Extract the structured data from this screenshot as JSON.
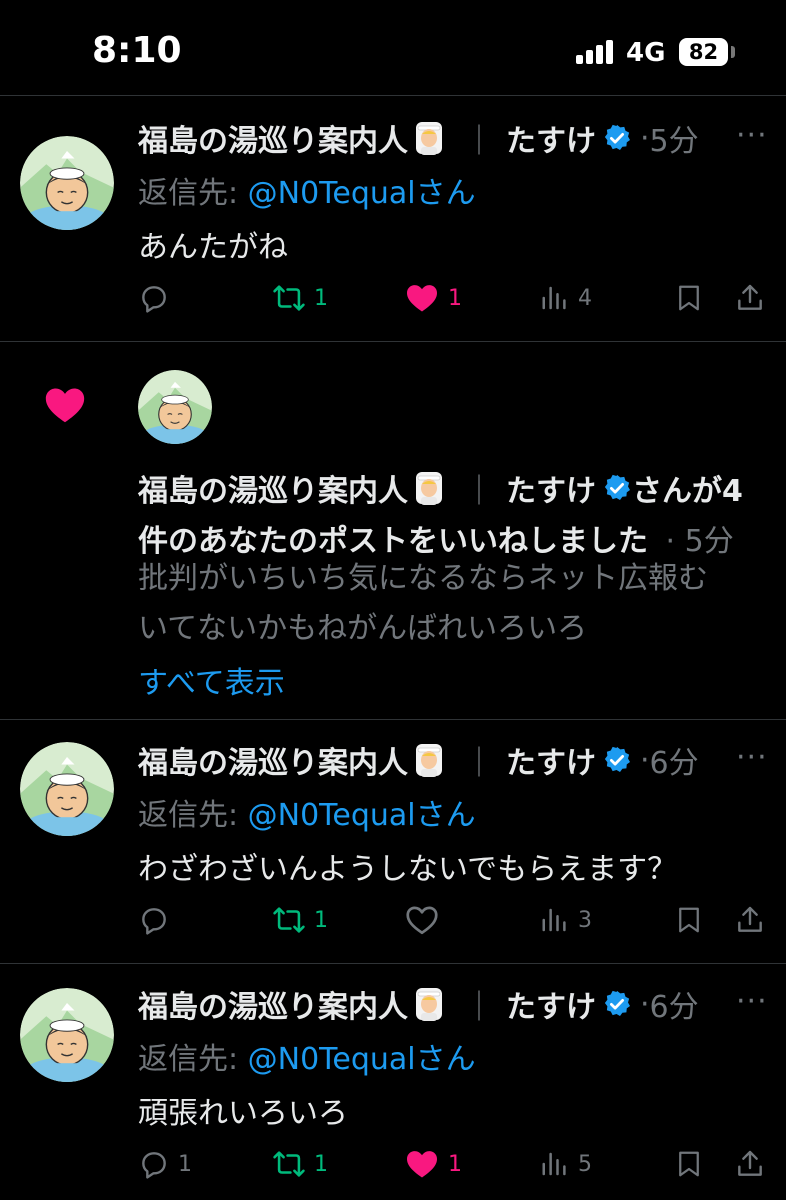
{
  "status_bar": {
    "time": "8:10",
    "network": "4G",
    "battery": "82"
  },
  "account": {
    "display_name": "福島の湯巡り案内人",
    "separator": "｜",
    "sub_name": "たすけ",
    "avatar_text": "fukushima"
  },
  "labels": {
    "reply_prefix": "返信先: ",
    "reply_handle": "@N0Tequal",
    "reply_suffix": "さん",
    "dot": "·"
  },
  "posts": [
    {
      "age": "5分",
      "text": "あんたがね",
      "reply_count": "",
      "repost_count": "1",
      "like_count": "1",
      "liked": true,
      "views": "4"
    },
    {
      "age": "6分",
      "text": "わざわざいんようしないでもらえます？",
      "reply_count": "",
      "repost_count": "1",
      "like_count": "",
      "liked": false,
      "views": "3"
    },
    {
      "age": "6分",
      "text": "頑張れいろいろ",
      "reply_count": "1",
      "repost_count": "1",
      "like_count": "1",
      "liked": true,
      "views": "5"
    }
  ],
  "notification": {
    "line1_suffix": "さんが4",
    "line2": "件のあなたのポストをいいねしました",
    "age": "5分",
    "preview_line1": "批判がいちいち気になるならネット広報む",
    "preview_line2": "いてないかもねがんばれいろいろ",
    "show_all": "すべて表示"
  },
  "colors": {
    "accent": "#1d9bf0",
    "like": "#f91880",
    "repost": "#00ba7c",
    "muted": "#71767b",
    "text": "#e7e9ea",
    "background": "#000000"
  }
}
